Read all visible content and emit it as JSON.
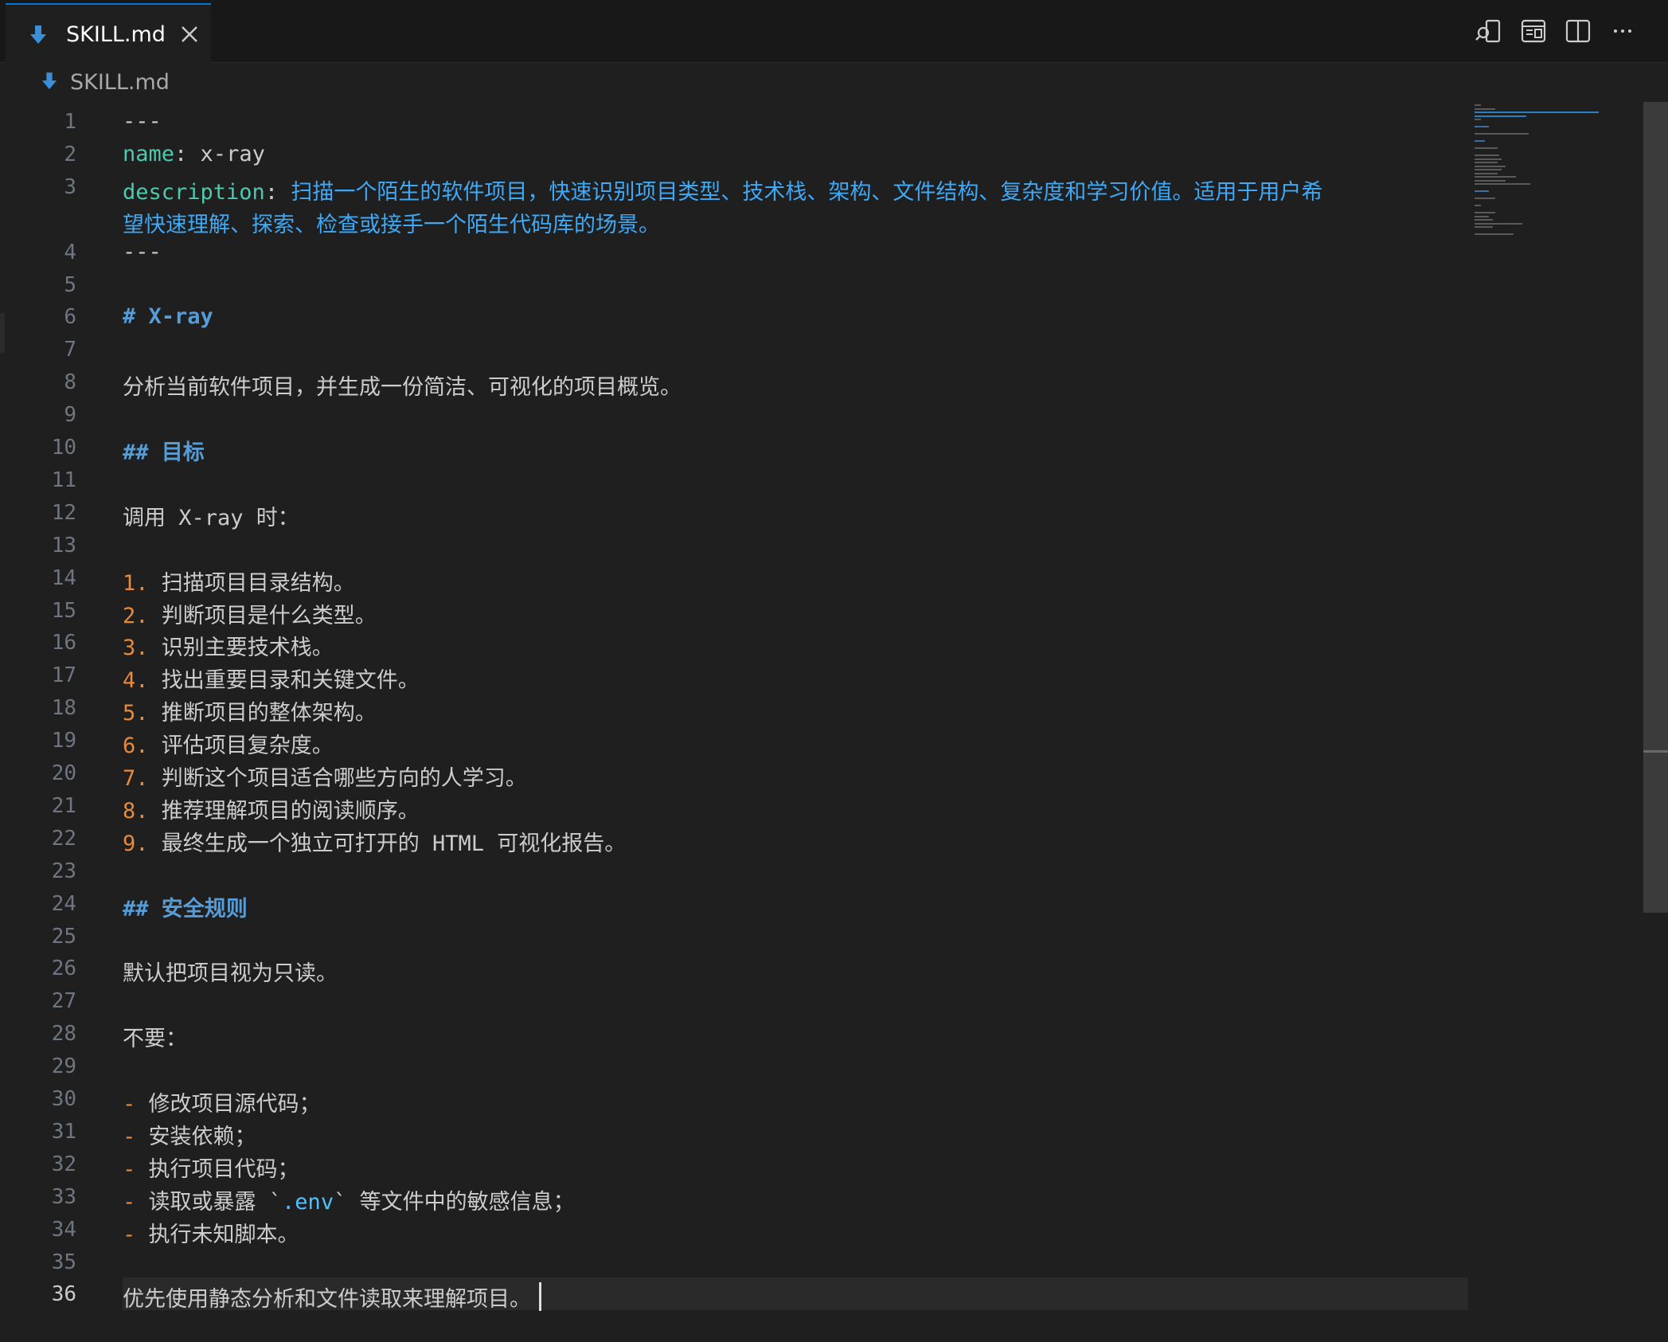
{
  "tab": {
    "label": "SKILL.md",
    "icon": "markdown-download-icon"
  },
  "breadcrumb": {
    "label": "SKILL.md"
  },
  "colors": {
    "accent": "#0078d4",
    "key": "#4ec9b0",
    "heading": "#569cd6",
    "list_marker": "#e88a3c"
  },
  "lines": [
    {
      "n": "1",
      "t": "---"
    },
    {
      "n": "2",
      "k": "name",
      "v": " x-ray"
    },
    {
      "n": "3",
      "k": "description",
      "v": " 扫描一个陌生的软件项目，快速识别项目类型、技术栈、架构、文件结构、复杂度和学习价值。适用于用户希"
    },
    {
      "n": "",
      "c": "望快速理解、探索、检查或接手一个陌生代码库的场景。"
    },
    {
      "n": "4",
      "t": "---"
    },
    {
      "n": "5",
      "t": ""
    },
    {
      "n": "6",
      "h": "# X-ray"
    },
    {
      "n": "7",
      "t": ""
    },
    {
      "n": "8",
      "t": "分析当前软件项目，并生成一份简洁、可视化的项目概览。"
    },
    {
      "n": "9",
      "t": ""
    },
    {
      "n": "10",
      "h": "## 目标"
    },
    {
      "n": "11",
      "t": ""
    },
    {
      "n": "12",
      "t": "调用 X-ray 时："
    },
    {
      "n": "13",
      "t": ""
    },
    {
      "n": "14",
      "m": "1.",
      "t": " 扫描项目目录结构。"
    },
    {
      "n": "15",
      "m": "2.",
      "t": " 判断项目是什么类型。"
    },
    {
      "n": "16",
      "m": "3.",
      "t": " 识别主要技术栈。"
    },
    {
      "n": "17",
      "m": "4.",
      "t": " 找出重要目录和关键文件。"
    },
    {
      "n": "18",
      "m": "5.",
      "t": " 推断项目的整体架构。"
    },
    {
      "n": "19",
      "m": "6.",
      "t": " 评估项目复杂度。"
    },
    {
      "n": "20",
      "m": "7.",
      "t": " 判断这个项目适合哪些方向的人学习。"
    },
    {
      "n": "21",
      "m": "8.",
      "t": " 推荐理解项目的阅读顺序。"
    },
    {
      "n": "22",
      "m": "9.",
      "t": " 最终生成一个独立可打开的 HTML 可视化报告。"
    },
    {
      "n": "23",
      "t": ""
    },
    {
      "n": "24",
      "h": "## 安全规则"
    },
    {
      "n": "25",
      "t": ""
    },
    {
      "n": "26",
      "t": "默认把项目视为只读。"
    },
    {
      "n": "27",
      "t": ""
    },
    {
      "n": "28",
      "t": "不要："
    },
    {
      "n": "29",
      "t": ""
    },
    {
      "n": "30",
      "m": "-",
      "t": " 修改项目源代码；"
    },
    {
      "n": "31",
      "m": "-",
      "t": " 安装依赖；"
    },
    {
      "n": "32",
      "m": "-",
      "t": " 执行项目代码；"
    },
    {
      "n": "33",
      "m": "-",
      "t": " 读取或暴露 ",
      "code": ".env",
      "after": " 等文件中的敏感信息；"
    },
    {
      "n": "34",
      "m": "-",
      "t": " 执行未知脚本。"
    },
    {
      "n": "35",
      "t": ""
    },
    {
      "n": "36",
      "t": "优先使用静态分析和文件读取来理解项目。",
      "current": true
    }
  ]
}
